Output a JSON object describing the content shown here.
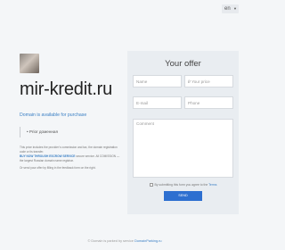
{
  "language": {
    "selected": "en",
    "chevron": "chevron-down-icon"
  },
  "domain": {
    "name": "mir-kredit.ru",
    "availability": "Domain is available for purchase",
    "category": "Prior доменная",
    "description_prefix": "This price includes the provider’s commission and tax, the domain registration code or its transfer.",
    "buy_link": "BUY NOW THROUGH ESCROW SERVICE",
    "description_suffix": "secure service. All COMISSION — the largest Russian domain name registrar.",
    "note": "Or send your offer by filling in the feedback form on the right."
  },
  "offer_form": {
    "title": "Your offer",
    "name_placeholder": "Name",
    "price_placeholder": "₽ Your price",
    "email_placeholder": "E-mail",
    "phone_placeholder": "Phone",
    "comment_placeholder": "Comment",
    "consent_prefix": "By submitting this form you agree to the",
    "consent_link": "Terms",
    "send_label": "SEND"
  },
  "footer": {
    "text": "© Domain is parked by service",
    "link": "DomainParking.ru"
  },
  "colors": {
    "accent": "#2d6fd0",
    "link": "#3a7fc4",
    "panel": "#e9edf1"
  }
}
